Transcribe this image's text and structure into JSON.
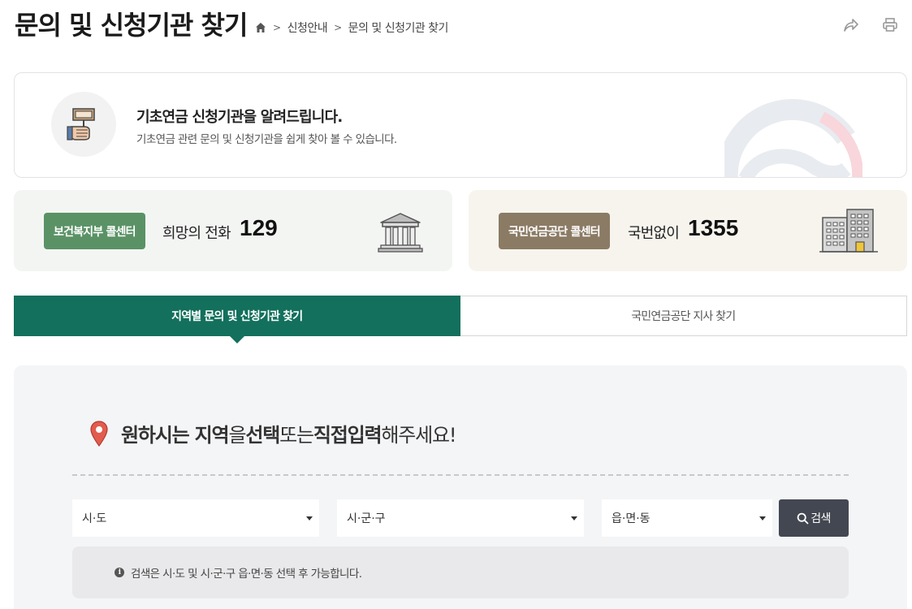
{
  "header": {
    "title": "문의 및 신청기관 찾기",
    "breadcrumb": [
      "신청안내",
      "문의 및 신청기관 찾기"
    ],
    "icons": [
      "home-icon",
      "share-icon",
      "print-icon"
    ]
  },
  "intro": {
    "title": "기초연금 신청기관을 알려드립니다.",
    "description": "기초연금 관련 문의 및 신청기관을 쉽게 찾아 볼 수 있습니다."
  },
  "call_centers": [
    {
      "badge": "보건복지부 콜센터",
      "label": "희망의 전화",
      "number": "129",
      "color": "#5a9266"
    },
    {
      "badge": "국민연금공단 콜센터",
      "label": "국번없이",
      "number": "1355",
      "color": "#8b7b65"
    }
  ],
  "tabs": [
    {
      "label": "지역별 문의 및 신청기관 찾기",
      "active": true
    },
    {
      "label": "국민연금공단 지사 찾기",
      "active": false
    }
  ],
  "search": {
    "heading_parts": [
      "원하시는 지역",
      "을 ",
      "선택",
      " 또는 ",
      "직접입력",
      "해주세요!"
    ],
    "selects": [
      "시·도",
      "시·군·구",
      "읍·면·동"
    ],
    "button_label": "검색",
    "notice": "검색은 시·도 및 시·군·구 읍·면·동 선택 후 가능합니다."
  },
  "colors": {
    "accent": "#12705c",
    "button": "#434751"
  }
}
